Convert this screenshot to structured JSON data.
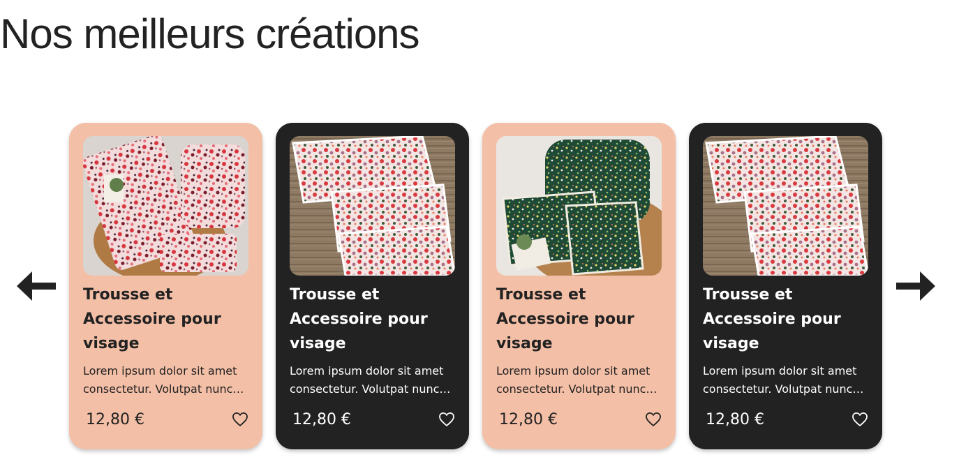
{
  "section": {
    "title": "Nos meilleurs créations"
  },
  "carousel": {
    "prev_icon": "arrow-left-icon",
    "next_icon": "arrow-right-icon",
    "cards": [
      {
        "theme": "light",
        "image": "floral-pouch-set-photo",
        "title": "Trousse et Accessoire pour visage",
        "description": "Lorem ipsum dolor sit amet consectetur. Volutpat nunc pellentesque",
        "price": "12,80 €",
        "favorite_icon": "heart-outline-icon"
      },
      {
        "theme": "dark",
        "image": "floral-wipes-photo",
        "title": "Trousse et Accessoire pour visage",
        "description": "Lorem ipsum dolor sit amet consectetur. Volutpat nunc pellentesque",
        "price": "12,80 €",
        "favorite_icon": "heart-outline-icon"
      },
      {
        "theme": "light",
        "image": "green-floral-set-photo",
        "title": "Trousse et Accessoire pour visage",
        "description": "Lorem ipsum dolor sit amet consectetur. Volutpat nunc pellentesque",
        "price": "12,80 €",
        "favorite_icon": "heart-outline-icon"
      },
      {
        "theme": "dark",
        "image": "floral-wipes-photo",
        "title": "Trousse et Accessoire pour visage",
        "description": "Lorem ipsum dolor sit amet consectetur. Volutpat nunc pellentesque",
        "price": "12,80 €",
        "favorite_icon": "heart-outline-icon"
      }
    ]
  },
  "colors": {
    "card_light": "#f4bfa7",
    "card_dark": "#222222",
    "text_dark": "#222222",
    "text_light": "#ffffff"
  }
}
